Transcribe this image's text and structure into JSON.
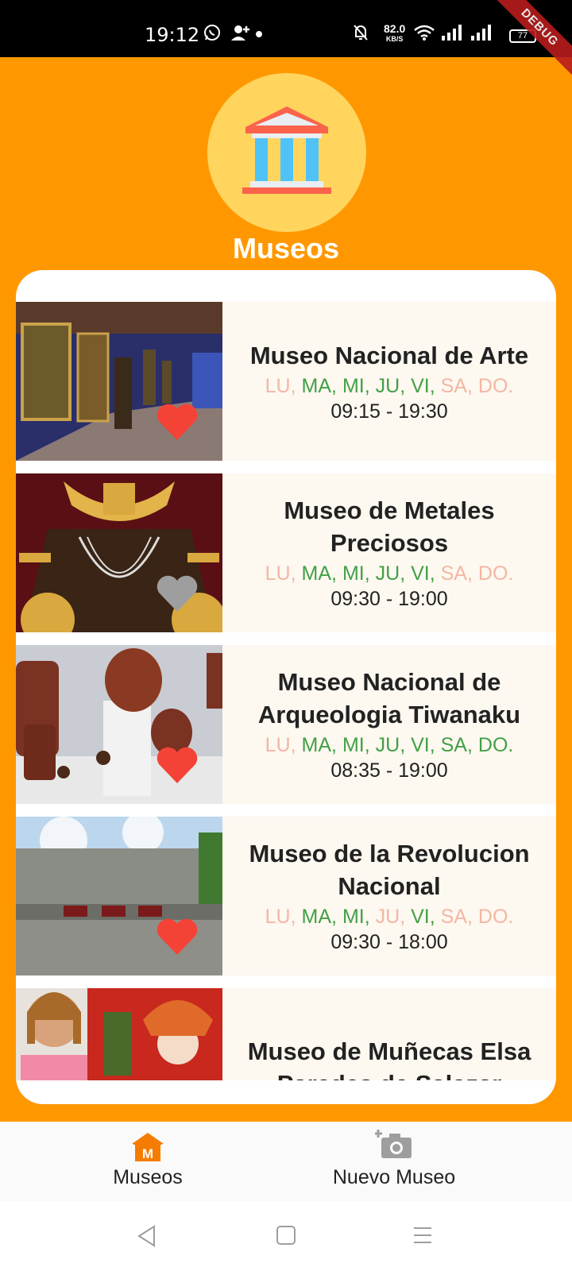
{
  "status_bar": {
    "time": "19:12",
    "net_speed": "82.0",
    "net_unit": "KB/S",
    "battery": "77",
    "debug_label": "DEBUG"
  },
  "header": {
    "title": "Museos",
    "logo_icon": "museum-building-icon"
  },
  "colors": {
    "accent": "#ff9800",
    "open_day": "#43a047",
    "closed_day": "#f4b6a4",
    "heart_fav": "#f44336",
    "heart_unfav": "#9e9e9e"
  },
  "museums": [
    {
      "name": "Museo Nacional de Arte",
      "days": [
        {
          "label": "LU",
          "open": false
        },
        {
          "label": "MA",
          "open": true
        },
        {
          "label": "MI",
          "open": true
        },
        {
          "label": "JU",
          "open": true
        },
        {
          "label": "VI",
          "open": true
        },
        {
          "label": "SA",
          "open": false
        },
        {
          "label": "DO.",
          "open": false
        }
      ],
      "hours": "09:15 - 19:30",
      "favorite": true
    },
    {
      "name": "Museo de Metales Preciosos",
      "days": [
        {
          "label": "LU",
          "open": false
        },
        {
          "label": "MA",
          "open": true
        },
        {
          "label": "MI",
          "open": true
        },
        {
          "label": "JU",
          "open": true
        },
        {
          "label": "VI",
          "open": true
        },
        {
          "label": "SA",
          "open": false
        },
        {
          "label": "DO.",
          "open": false
        }
      ],
      "hours": "09:30 - 19:00",
      "favorite": false
    },
    {
      "name": "Museo Nacional de Arqueologia Tiwanaku",
      "days": [
        {
          "label": "LU",
          "open": false
        },
        {
          "label": "MA",
          "open": true
        },
        {
          "label": "MI",
          "open": true
        },
        {
          "label": "JU",
          "open": true
        },
        {
          "label": "VI",
          "open": true
        },
        {
          "label": "SA",
          "open": true
        },
        {
          "label": "DO.",
          "open": true
        }
      ],
      "hours": "08:35 - 19:00",
      "favorite": true
    },
    {
      "name": "Museo de la Revolucion Nacional",
      "days": [
        {
          "label": "LU",
          "open": false
        },
        {
          "label": "MA",
          "open": true
        },
        {
          "label": "MI",
          "open": true
        },
        {
          "label": "JU",
          "open": false
        },
        {
          "label": "VI",
          "open": true
        },
        {
          "label": "SA",
          "open": false
        },
        {
          "label": "DO.",
          "open": false
        }
      ],
      "hours": "09:30 - 18:00",
      "favorite": true
    },
    {
      "name": "Museo de Muñecas Elsa Paredes de Salazar",
      "days": [],
      "hours": "",
      "favorite": false
    }
  ],
  "bottom_nav": {
    "tabs": [
      {
        "label": "Museos",
        "icon": "museum-home-icon"
      },
      {
        "label": "Nuevo Museo",
        "icon": "add-photo-icon"
      }
    ]
  }
}
